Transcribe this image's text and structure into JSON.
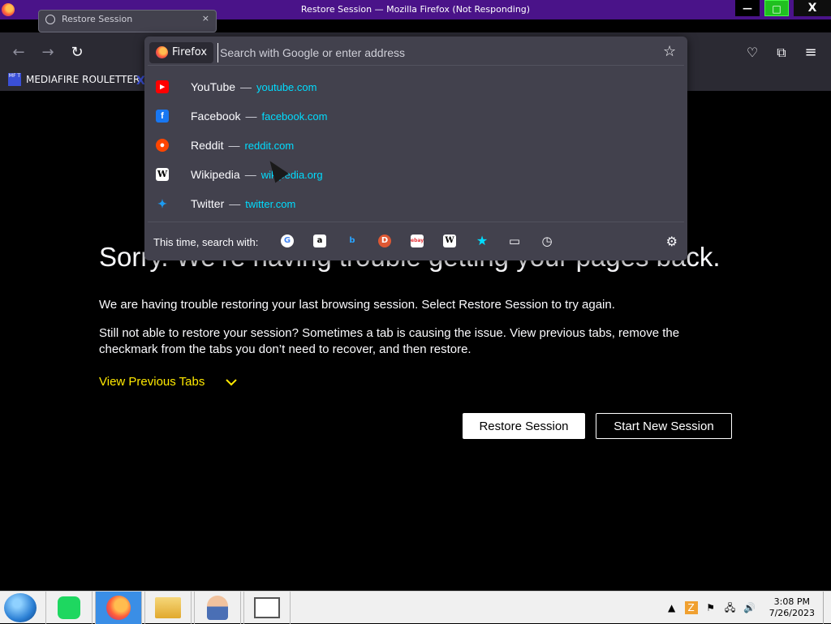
{
  "window": {
    "title": "Restore Session — Mozilla Firefox (Not Responding)",
    "min_label": "—",
    "max_label": "□",
    "close_label": "X"
  },
  "tab": {
    "label": "Restore Session",
    "close": "×"
  },
  "bookmarks": [
    {
      "label": "MEDIAFIRE ROULETTER",
      "icon": "MF T"
    }
  ],
  "urlbar": {
    "engine": "Firefox",
    "placeholder": "Search with Google or enter address"
  },
  "suggestions": [
    {
      "name": "YouTube",
      "url": "youtube.com",
      "icon": "youtube-icon",
      "color": "#ff0000"
    },
    {
      "name": "Facebook",
      "url": "facebook.com",
      "icon": "facebook-icon",
      "color": "#1877f2"
    },
    {
      "name": "Reddit",
      "url": "reddit.com",
      "icon": "reddit-icon",
      "color": "#ff4500"
    },
    {
      "name": "Wikipedia",
      "url": "wikipedia.org",
      "icon": "wikipedia-icon",
      "color": "#ffffff"
    },
    {
      "name": "Twitter",
      "url": "twitter.com",
      "icon": "twitter-icon",
      "color": "#1d9bf0"
    }
  ],
  "separator": "—",
  "oneoff": {
    "label": "This time, search with:",
    "engines": [
      {
        "icon": "google-icon",
        "glyph": "G"
      },
      {
        "icon": "amazon-icon",
        "glyph": "a"
      },
      {
        "icon": "bing-icon",
        "glyph": "b"
      },
      {
        "icon": "duckduckgo-icon",
        "glyph": "D"
      },
      {
        "icon": "ebay-icon",
        "glyph": "ebay"
      },
      {
        "icon": "wikipedia-icon",
        "glyph": "W"
      },
      {
        "icon": "bookmarks-icon",
        "glyph": "★"
      },
      {
        "icon": "tabs-icon",
        "glyph": "▭"
      },
      {
        "icon": "history-icon",
        "glyph": "◷"
      }
    ]
  },
  "page": {
    "heading": "Sorry. We’re having trouble getting your pages back.",
    "para1": "We are having trouble restoring your last browsing session. Select Restore Session to try again.",
    "para2": "Still not able to restore your session? Sometimes a tab is causing the issue. View previous tabs, remove the checkmark from the tabs you don’t need to recover, and then restore.",
    "view_previous": "View Previous Tabs",
    "restore_button": "Restore Session",
    "new_session_button": "Start New Session"
  },
  "taskbar": {
    "time": "3:08 PM",
    "date": "7/26/2023"
  },
  "colors": {
    "titlebar": "#4a1389",
    "accent_link": "#00ddff",
    "view_previous": "#ffe900",
    "popup_bg": "#42414d"
  }
}
